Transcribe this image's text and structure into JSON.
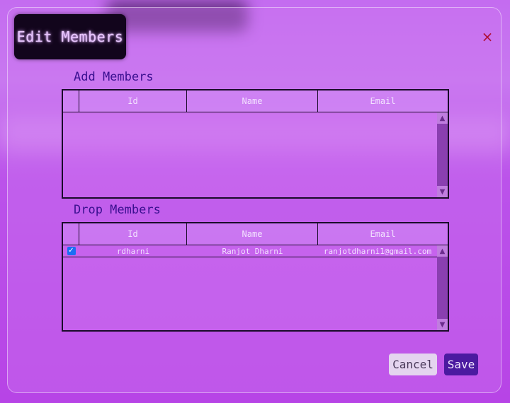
{
  "dialog": {
    "title": "Edit Members",
    "close_icon": "close-icon",
    "close_glyph": "×"
  },
  "add_section": {
    "label": "Add Members",
    "columns": [
      "",
      "Id",
      "Name",
      "Email"
    ],
    "rows": []
  },
  "drop_section": {
    "label": "Drop Members",
    "columns": [
      "",
      "Id",
      "Name",
      "Email"
    ],
    "rows": [
      {
        "checked": true,
        "id": "rdharni",
        "name": "Ranjot Dharni",
        "email": "ranjotdharni1@gmail.com"
      }
    ]
  },
  "buttons": {
    "cancel": "Cancel",
    "save": "Save"
  },
  "colors": {
    "accent": "#4b1aa0",
    "close": "#b0103a",
    "checkbox": "#1b6ef3"
  }
}
